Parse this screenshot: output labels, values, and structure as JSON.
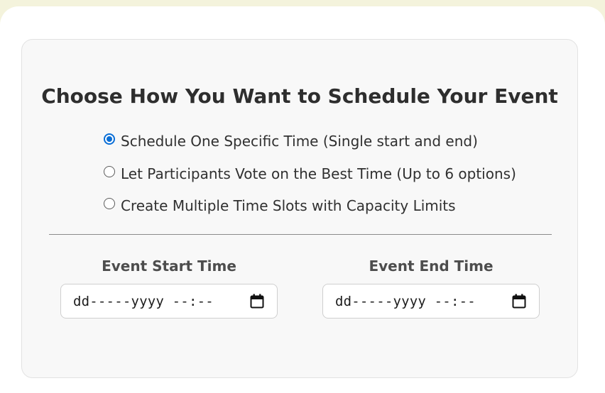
{
  "page_title": "Choose How You Want to Schedule Your Event",
  "schedule_options": [
    {
      "label": "Schedule One Specific Time (Single start and end)",
      "checked": true
    },
    {
      "label": "Let Participants Vote on the Best Time (Up to 6 options)",
      "checked": false
    },
    {
      "label": "Create Multiple Time Slots with Capacity Limits",
      "checked": false
    }
  ],
  "start_field": {
    "label": "Event Start Time",
    "value_placeholder": "dd-----yyyy --:--",
    "icon": "calendar-icon"
  },
  "end_field": {
    "label": "Event End Time",
    "value_placeholder": "dd-----yyyy --:--",
    "icon": "calendar-icon"
  },
  "colors": {
    "page_background": "#f4f3dc",
    "card_background": "#ffffff",
    "panel_background": "#f8f8f8",
    "radio_accent": "#0a6ed6",
    "title_text": "#2e2e2e",
    "divider": "#8a8a8a"
  }
}
